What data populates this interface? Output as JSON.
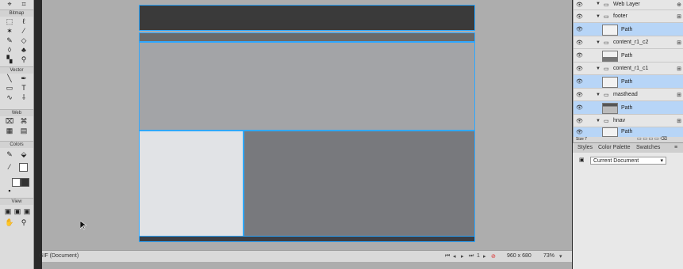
{
  "tools": {
    "sections": [
      "Bitmap",
      "Vector",
      "Web",
      "Colors",
      "View"
    ]
  },
  "status": {
    "file_type": "GIF (Document)",
    "dimensions": "960 x 680",
    "zoom": "73%"
  },
  "layers": {
    "top_layer": "Web Layer",
    "items": [
      {
        "name": "footer",
        "path": "Path"
      },
      {
        "name": "content_r1_c2",
        "path": "Path"
      },
      {
        "name": "content_r1_c1",
        "path": "Path"
      },
      {
        "name": "masthead",
        "path": "Path"
      },
      {
        "name": "hnav",
        "path": "Path"
      }
    ],
    "bottom_label": "Size 7"
  },
  "panels": {
    "tabs": [
      "Styles",
      "Color Palette",
      "Swatches"
    ],
    "document_select": "Current Document"
  },
  "colors": {
    "accent": "#2fa8ff",
    "header": "#3a3a3a",
    "nav": "#6a6a6a",
    "masthead": "#a3a4a7",
    "sidebar": "#e1e3e6",
    "content": "#78797d",
    "footer": "#3b3e44"
  }
}
